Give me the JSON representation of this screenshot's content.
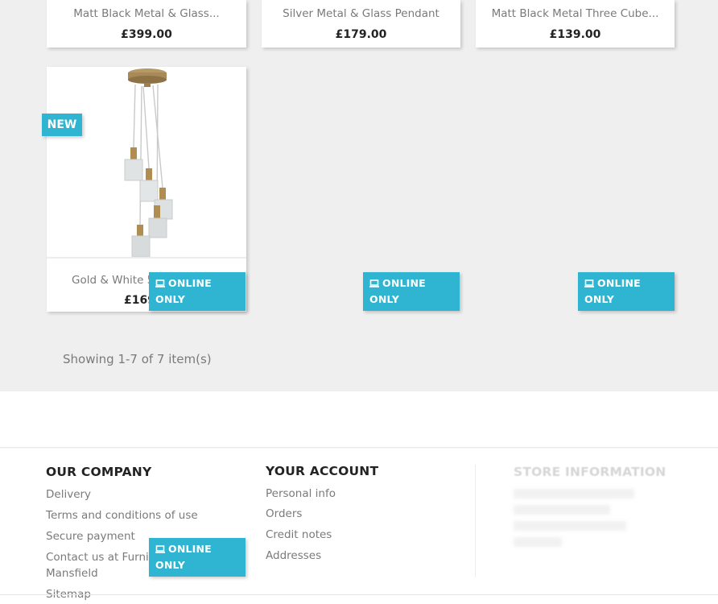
{
  "products_top": [
    {
      "name": "Matt Black Metal & Glass...",
      "price": "£399.00"
    },
    {
      "name": "Silver Metal & Glass Pendant",
      "price": "£179.00"
    },
    {
      "name": "Matt Black Metal Three Cube...",
      "price": "£139.00"
    }
  ],
  "featured_product": {
    "badge": "NEW",
    "name": "Gold & White 5",
    "price": "£169"
  },
  "badges": {
    "online_only_line1": "ONLINE",
    "online_only_line2": "ONLY"
  },
  "pagination": {
    "summary": "Showing 1-7 of 7 item(s)"
  },
  "footer": {
    "company": {
      "title": "OUR COMPANY",
      "links": [
        "Delivery",
        "Terms and conditions of use",
        "Secure payment",
        "Contact us at Furnish",
        "Mansfield",
        "Sitemap"
      ]
    },
    "account": {
      "title": "YOUR ACCOUNT",
      "links": [
        "Personal info",
        "Orders",
        "Credit notes",
        "Addresses"
      ]
    },
    "store": {
      "title": "STORE INFORMATION"
    }
  },
  "colors": {
    "accent": "#2fb5d2",
    "page_bg": "#efefef"
  },
  "icons": {
    "badge_icon": "laptop-icon"
  }
}
